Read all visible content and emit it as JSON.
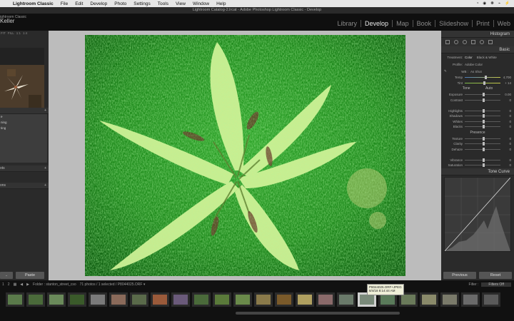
{
  "menubar": {
    "app": "Lightroom Classic",
    "items": [
      "File",
      "Edit",
      "Develop",
      "Photo",
      "Settings",
      "Tools",
      "View",
      "Window",
      "Help"
    ],
    "status": [
      "◔",
      "◉",
      "❋",
      "⌁",
      "⚡"
    ]
  },
  "window_title": "Lightroom Catalog-2.lrcat - Adobe Photoshop Lightroom Classic - Develop",
  "identity": {
    "line1": "ightroom Classic",
    "name": "Keller"
  },
  "modules": [
    "Library",
    "Develop",
    "Map",
    "Book",
    "Slideshow",
    "Print",
    "Web"
  ],
  "active_module": "Develop",
  "left_panel": {
    "header": [
      "FIT",
      "FILL",
      "1:1",
      "1:4"
    ],
    "sections": [
      {
        "label": "",
        "plus": "+"
      },
      {
        "label": "ots",
        "plus": "+"
      },
      {
        "label": "ons",
        "plus": "+"
      }
    ],
    "preset_items": [
      "e",
      "",
      "",
      "",
      "",
      "ning",
      "ting"
    ],
    "copy_label": "..",
    "paste_label": "Paste"
  },
  "right_panel": {
    "histogram_label": "Histogram",
    "basic_label": "Basic",
    "treatment": {
      "label": "Treatment:",
      "color": "Color",
      "bw": "Black & White"
    },
    "profile": {
      "label": "Profile:",
      "value": "Adobe Color"
    },
    "wb": {
      "label": "WB :",
      "value": "As Shot"
    },
    "temp_tint": [
      {
        "label": "Temp",
        "val": "4,700",
        "pos": 0.55,
        "color": "#4a7ab8"
      },
      {
        "label": "Tint",
        "val": "+ 14",
        "pos": 0.52,
        "color": "#7ab84a"
      }
    ],
    "tone": {
      "label": "Tone",
      "auto": "Auto"
    },
    "tone_sliders": [
      {
        "label": "Exposure",
        "val": "0.00",
        "pos": 0.5
      },
      {
        "label": "Contrast",
        "val": "0",
        "pos": 0.5
      },
      {
        "label": "",
        "val": "",
        "pos": null
      },
      {
        "label": "Highlights",
        "val": "0",
        "pos": 0.5
      },
      {
        "label": "Shadows",
        "val": "0",
        "pos": 0.5
      },
      {
        "label": "Whites",
        "val": "0",
        "pos": 0.5
      },
      {
        "label": "Blacks",
        "val": "0",
        "pos": 0.5
      }
    ],
    "presence_label": "Presence",
    "presence_sliders": [
      {
        "label": "Texture",
        "val": "0",
        "pos": 0.5
      },
      {
        "label": "Clarity",
        "val": "0",
        "pos": 0.5
      },
      {
        "label": "Dehaze",
        "val": "0",
        "pos": 0.5
      },
      {
        "label": "",
        "val": "",
        "pos": null
      },
      {
        "label": "Vibrance",
        "val": "0",
        "pos": 0.5
      },
      {
        "label": "Saturation",
        "val": "0",
        "pos": 0.5
      }
    ],
    "tone_curve_label": "Tone Curve",
    "previous_label": "Previous",
    "reset_label": "Reset"
  },
  "filmstrip": {
    "page1": "1",
    "page2": "2",
    "folder": "Folder : stanton_street_cso",
    "count": "71 photos / 1 selected / P8044025.ORF ▾",
    "filter_label": "Filter :",
    "filter_value": "Filters Off",
    "thumbs": [
      "#5a7a4a",
      "#4a6a3a",
      "#6a8a5a",
      "#3a5a2a",
      "#7a7a7a",
      "#8a6a5a",
      "#5a6a4a",
      "#9a5a3a",
      "#6a5a7a",
      "#4a6a3a",
      "#5a7a3a",
      "#6a8a4a",
      "#8a7a4a",
      "#7a5a2a",
      "#b0a060",
      "#8a6a6a",
      "#6a7a6a",
      "#7a8a7a",
      "#5a7a5a",
      "#6a7a5a",
      "#8a8a6a",
      "#7a7a6a",
      "#6a6a6a",
      "#5a5a5a"
    ],
    "selected_index": 17,
    "tooltip": [
      "P8044025.ORF+JPEG",
      "8/4/18 8:14:44 AM"
    ]
  }
}
